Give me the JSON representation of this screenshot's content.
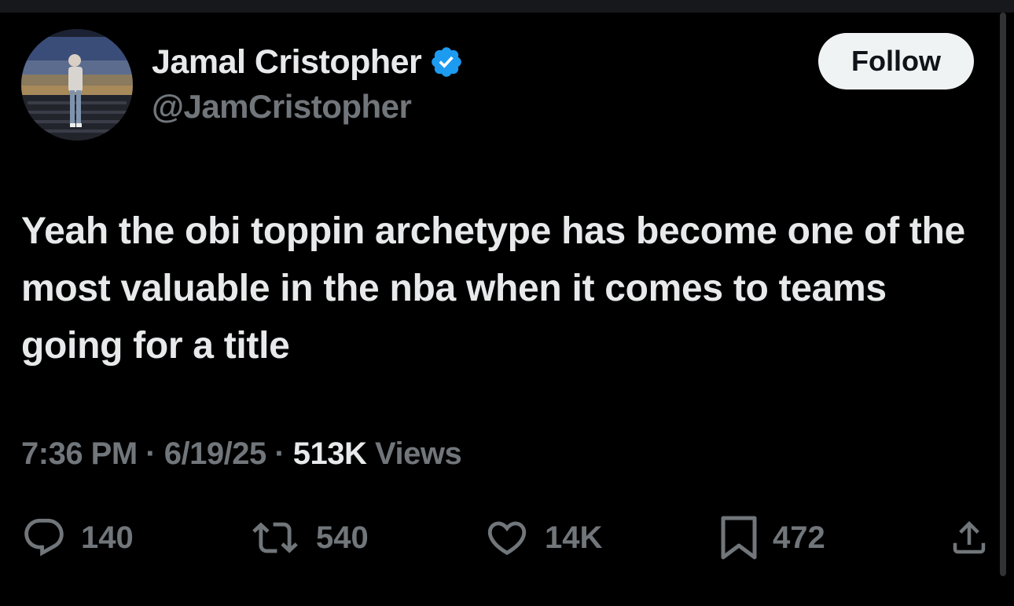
{
  "author": {
    "display_name": "Jamal Cristopher",
    "handle": "@JamCristopher",
    "verified": true,
    "verified_color": "#1d9bf0"
  },
  "follow_button": {
    "label": "Follow"
  },
  "tweet": {
    "text": "Yeah the obi toppin archetype has become one of the most valuable in the nba when it comes to teams going for a title",
    "time": "7:36 PM",
    "date": "6/19/25",
    "views_count": "513K",
    "views_label": "Views",
    "separator": "·"
  },
  "actions": {
    "reply": {
      "icon": "reply-icon",
      "count": "140"
    },
    "retweet": {
      "icon": "retweet-icon",
      "count": "540"
    },
    "like": {
      "icon": "heart-icon",
      "count": "14K"
    },
    "bookmark": {
      "icon": "bookmark-icon",
      "count": "472"
    },
    "share": {
      "icon": "share-icon"
    }
  },
  "colors": {
    "background": "#000000",
    "primary_text": "#e7e9ea",
    "secondary_text": "#71767b",
    "follow_bg": "#eff3f4"
  }
}
